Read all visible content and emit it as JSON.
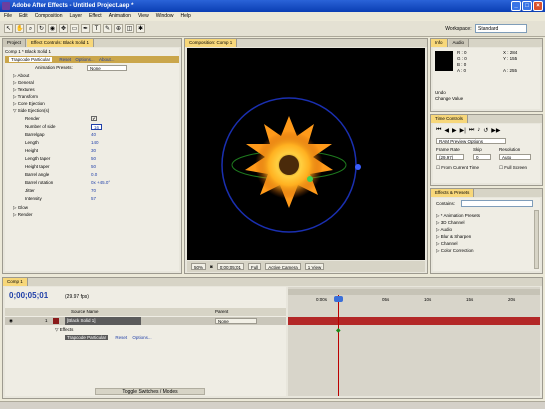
{
  "window": {
    "title": "Adobe After Effects - Untitled Project.aep *"
  },
  "menu": [
    "File",
    "Edit",
    "Composition",
    "Layer",
    "Effect",
    "Animation",
    "View",
    "Window",
    "Help"
  ],
  "toolbar": {
    "workspace_label": "Workspace:",
    "workspace_value": "Standard"
  },
  "project_panel": {
    "tabs": [
      "Project",
      "Effect Controls: Black Solid 1"
    ],
    "breadcrumb": "Comp 1 * Black Solid 1",
    "effect_name": "Trapcode Particular",
    "reset": "Reset",
    "options": "Options...",
    "about": "About...",
    "animation_presets_label": "Animation Presets:",
    "animation_presets_value": "None",
    "groups": [
      "About",
      "General",
      "Textures",
      "Transform",
      "Core Ejection",
      "Side Ejection(s)"
    ],
    "props": [
      {
        "label": "Render",
        "value": "✔"
      },
      {
        "label": "Number of side",
        "value": "16"
      },
      {
        "label": "Barrelgap",
        "value": "40"
      },
      {
        "label": "Length",
        "value": "140"
      },
      {
        "label": "Height",
        "value": "30"
      },
      {
        "label": "Length taper",
        "value": "50"
      },
      {
        "label": "Height taper",
        "value": "50"
      },
      {
        "label": "Barrel angle",
        "value": "0.0"
      },
      {
        "label": "Barrel rotation",
        "value": "0x +45.0°"
      },
      {
        "label": "Jitter",
        "value": "70"
      },
      {
        "label": "Intensity",
        "value": "57"
      }
    ],
    "tail_groups": [
      "Glow",
      "Render"
    ]
  },
  "comp_panel": {
    "tab": "Composition: Comp 1",
    "zoom": "50%",
    "timecode": "0;00;05;01",
    "resolution": "Full",
    "camera": "Active Camera",
    "view": "1 View"
  },
  "info_panel": {
    "tabs": [
      "Info",
      "Audio"
    ],
    "r": "R : 0",
    "g": "G : 0",
    "b": "B : 0",
    "a": "A : 0",
    "x": "X : 284",
    "y": "Y : 155",
    "extra": "A : 255",
    "undo": "Undo",
    "change_value": "Change Value"
  },
  "time_controls": {
    "tab": "Time Controls",
    "preview_options": "RAM Preview Options",
    "frame_rate_label": "Frame Rate",
    "skip_label": "Skip",
    "resolution_label": "Resolution",
    "frame_rate": "(29.97)",
    "skip": "0",
    "resolution": "Auto",
    "from_current": "From Current Time",
    "full_screen": "Full Screen"
  },
  "effects_presets": {
    "tab": "Effects & Presets",
    "search_label": "Contains:",
    "items": [
      "* Animation Presets",
      "3D Channel",
      "Audio",
      "Blur & Sharpen",
      "Channel",
      "Color Correction"
    ]
  },
  "timeline": {
    "tab": "Comp 1",
    "timecode": "0;00;05;01",
    "fps": "(29.97 fps)",
    "col_source": "Source Name",
    "col_parent": "Parent",
    "layer_num": "1",
    "layer_name": "[Black Solid 1]",
    "parent_value": "None",
    "effects_label": "Effects",
    "effect_row": "Trapcode Particular",
    "reset": "Reset",
    "options": "Options...",
    "ruler": [
      "0:00s",
      "05s",
      "10s",
      "15s",
      "20s",
      "25s"
    ],
    "toggle": "Toggle Switches / Modes"
  }
}
